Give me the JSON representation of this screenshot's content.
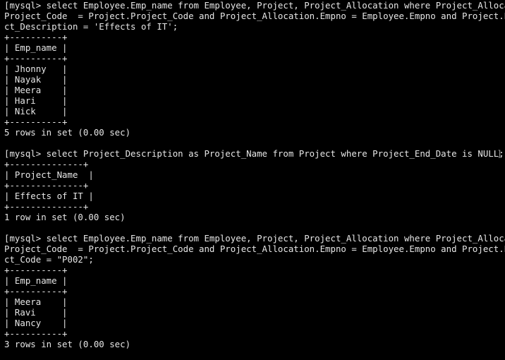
{
  "terminal": {
    "lines": [
      "[mysql> select Employee.Emp_name from Employee, Project, Project_Allocation where Project_Allocation.]",
      "Project_Code  = Project.Project_Code and Project_Allocation.Empno = Employee.Empno and Project.Proje",
      "ct_Description = 'Effects of IT';",
      "+----------+",
      "| Emp_name |",
      "+----------+",
      "| Jhonny   |",
      "| Nayak    |",
      "| Meera    |",
      "| Hari     |",
      "| Nick     |",
      "+----------+",
      "5 rows in set (0.00 sec)",
      "",
      "[mysql> select Project_Description as Project_Name from Project where Project_End_Date is NULL;",
      "+--------------+",
      "| Project_Name  |",
      "+--------------+",
      "| Effects of IT |",
      "+--------------+",
      "1 row in set (0.00 sec)",
      "",
      "[mysql> select Employee.Emp_name from Employee, Project, Project_Allocation where Project_Allocation.]",
      "Project_Code  = Project.Project_Code and Project_Allocation.Empno = Employee.Empno and Project.Proje",
      "ct_Code = \"P002\";",
      "+----------+",
      "| Emp_name |",
      "+----------+",
      "| Meera    |",
      "| Ravi     |",
      "| Nancy    |",
      "+----------+",
      "3 rows in set (0.00 sec)"
    ],
    "line_bracket": "]",
    "colors": {
      "background": "#000000",
      "text": "#e6e6e6"
    }
  }
}
